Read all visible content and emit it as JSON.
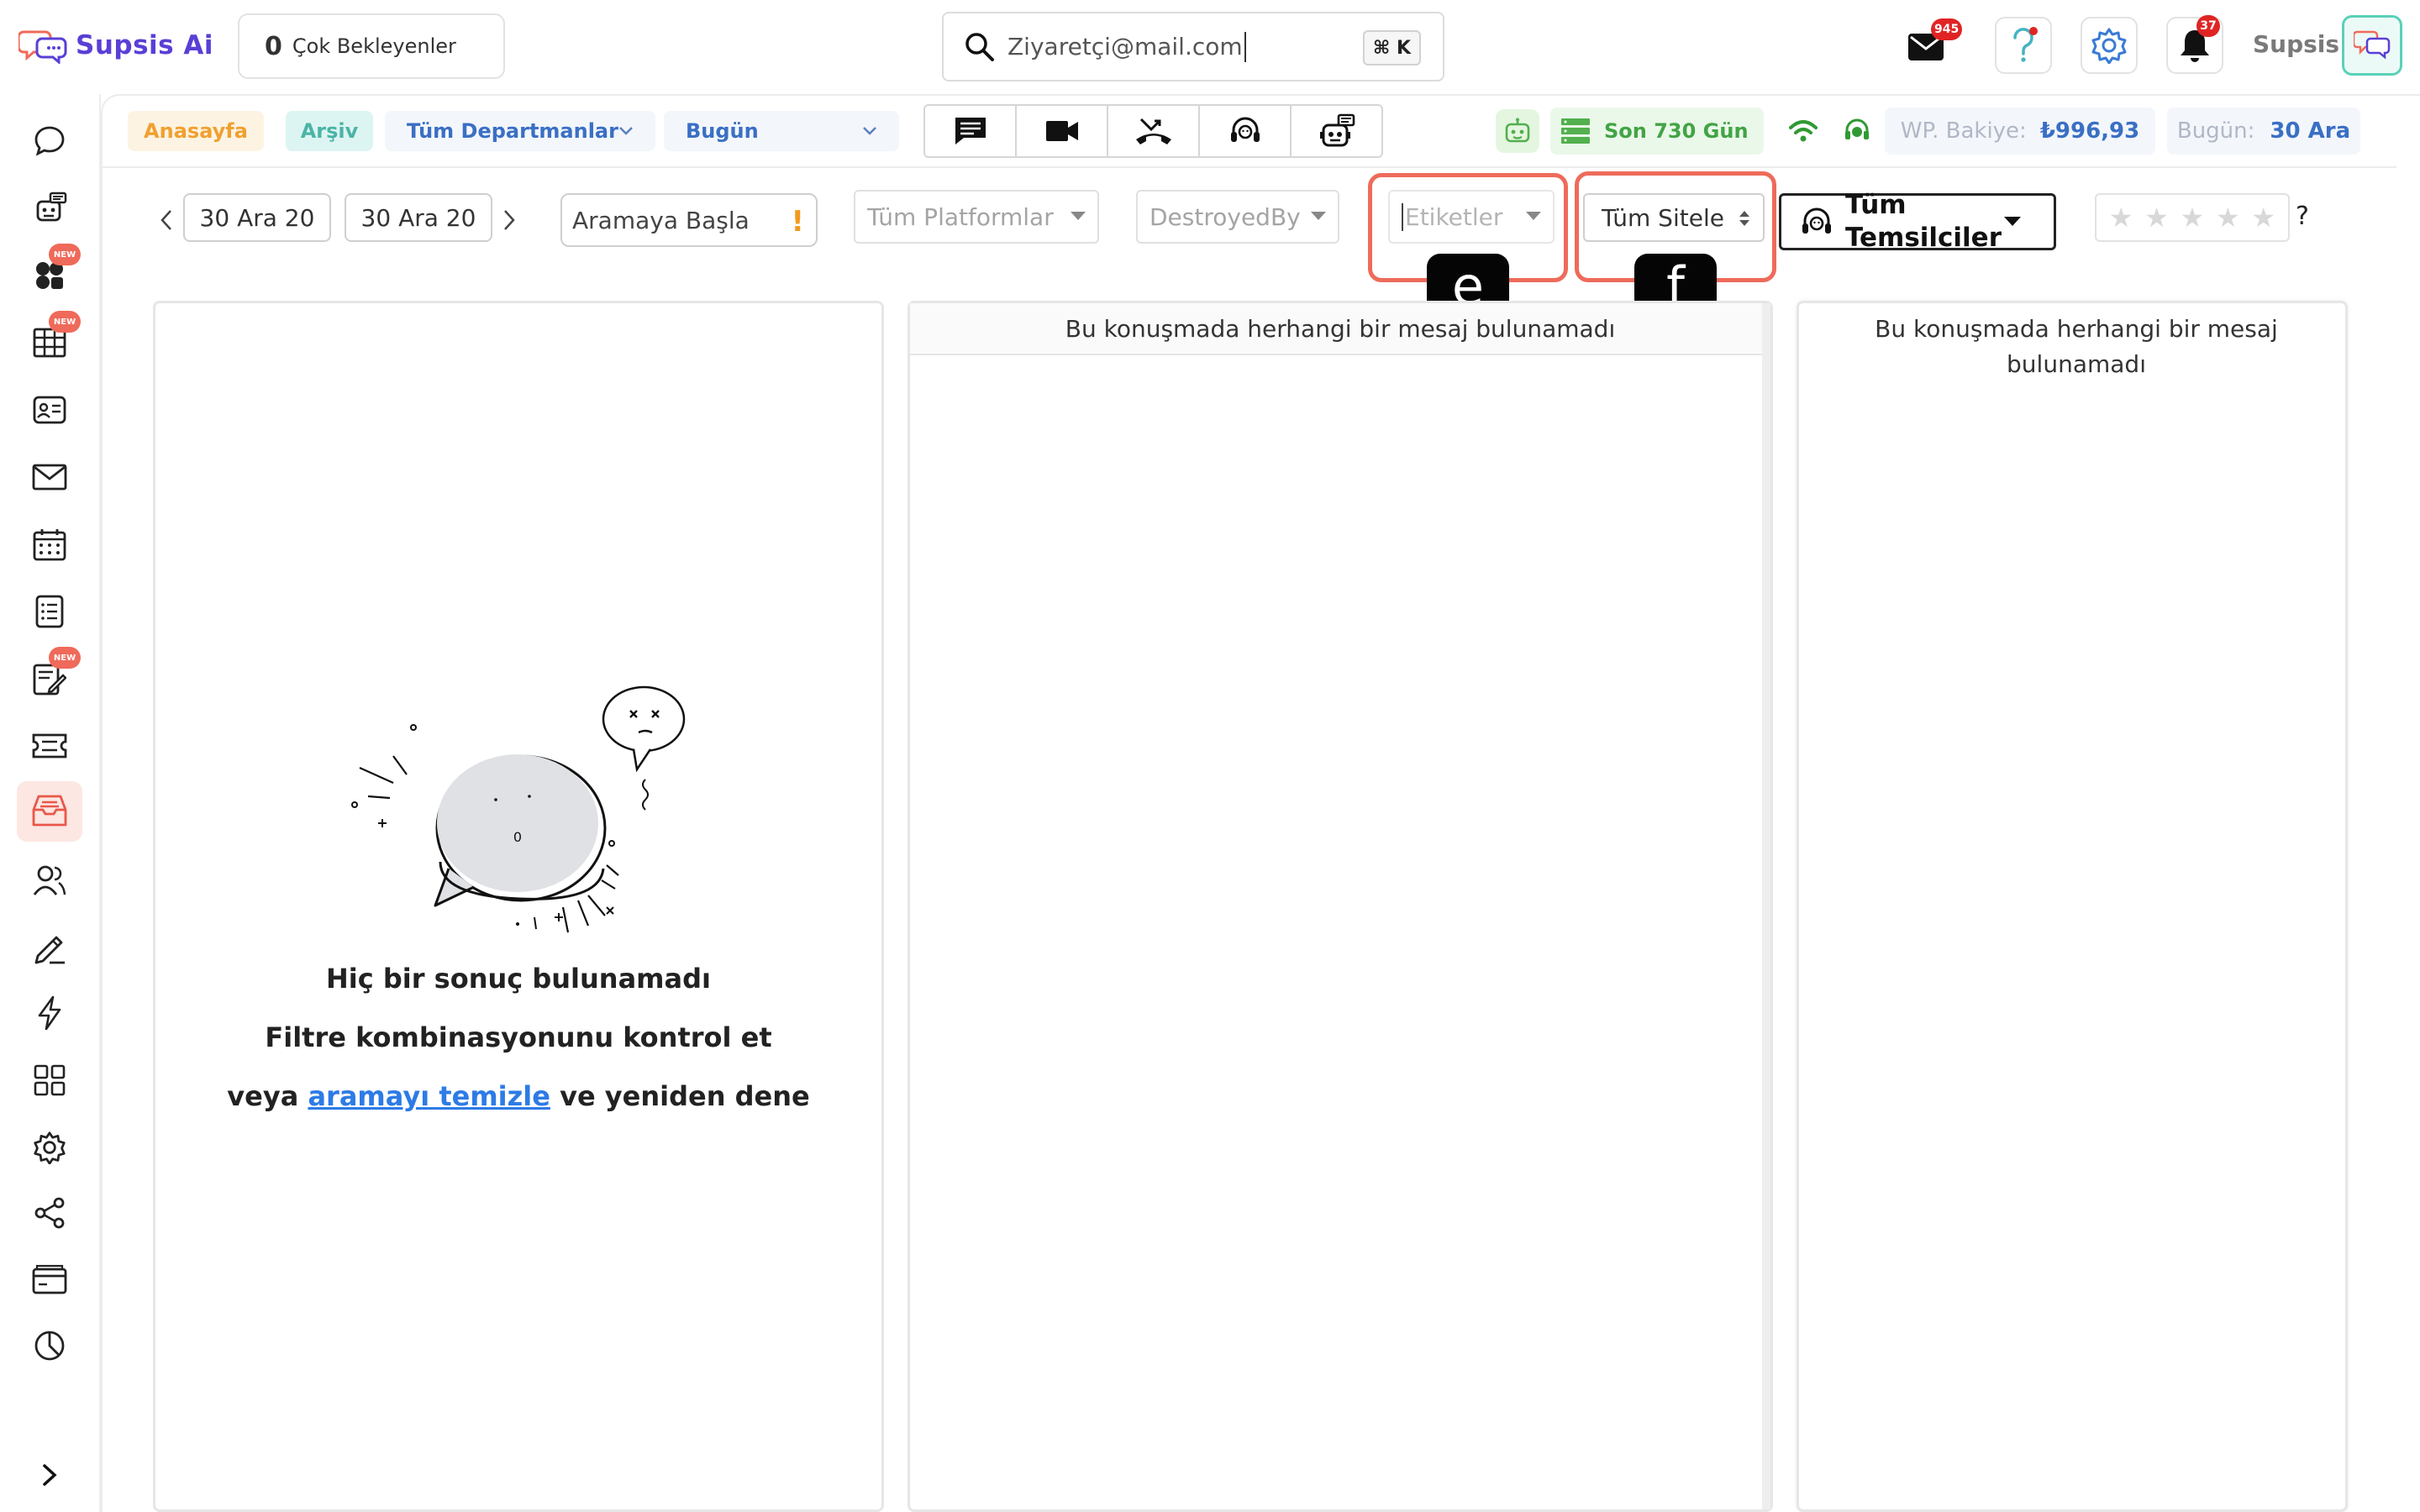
{
  "app": {
    "name": "Supsis Ai",
    "username": "Supsis"
  },
  "header": {
    "waiting_count": "0",
    "waiting_label": "Çok Bekleyenler",
    "search_value": "Ziyaretçi@mail.com",
    "search_shortcut": "⌘ K",
    "mail_badge": "945",
    "notif_badge": "37"
  },
  "toolbar": {
    "home_tab": "Anasayfa",
    "archive_tab": "Arşiv",
    "department_select": "Tüm Departmanlar",
    "date_select": "Bugün",
    "days_label": "Son 730 Gün",
    "wp_balance_label": "WP. Bakiye:",
    "wp_balance_value": "₺996,93",
    "today_label": "Bugün:",
    "today_value": "30 Ara"
  },
  "filters": {
    "date_from": "30 Ara 20",
    "date_to": "30 Ara 20",
    "start_search": "Aramaya Başla",
    "start_search_flag": "!",
    "platforms": "Tüm Platformlar",
    "destroyed_by": "DestroyedBy",
    "tags_placeholder": "Etiketler",
    "sites": "Tüm Sitele",
    "representatives": "Tüm Temsilciler",
    "rating_help": "?",
    "marker_e": "e",
    "marker_f": "f"
  },
  "panels": {
    "middle_empty": "Bu konuşmada herhangi bir mesaj bulunamadı",
    "right_empty": "Bu konuşmada herhangi bir mesaj bulunamadı",
    "illustration_count": "0",
    "no_result_title": "Hiç bir sonuç bulunamadı",
    "no_result_hint": "Filtre kombinasyonunu kontrol et",
    "no_result_prefix": "veya",
    "clear_search_link": "aramayı temizle",
    "no_result_suffix": "ve yeniden dene"
  },
  "sidebar": {
    "new_badge": "NEW",
    "items": [
      {
        "icon": "chat-bubble-icon"
      },
      {
        "icon": "robot-icon"
      },
      {
        "icon": "apps-new-icon"
      },
      {
        "icon": "table-grid-icon"
      },
      {
        "icon": "contact-card-icon"
      },
      {
        "icon": "mail-icon"
      },
      {
        "icon": "calendar-icon"
      },
      {
        "icon": "list-icon"
      },
      {
        "icon": "notes-edit-icon"
      },
      {
        "icon": "ticket-icon"
      },
      {
        "icon": "inbox-archive-icon"
      },
      {
        "icon": "users-icon"
      },
      {
        "icon": "pen-icon"
      },
      {
        "icon": "lightning-icon"
      },
      {
        "icon": "widgets-grid-icon"
      },
      {
        "icon": "settings-gear-icon"
      },
      {
        "icon": "share-icon"
      },
      {
        "icon": "billing-icon"
      },
      {
        "icon": "reports-pie-icon"
      }
    ]
  },
  "colors": {
    "brand": "#5a3fd6",
    "accent_blue": "#3a6fc4",
    "highlight": "#ee6b5b",
    "success": "#42a444",
    "badge_red": "#e02424"
  }
}
